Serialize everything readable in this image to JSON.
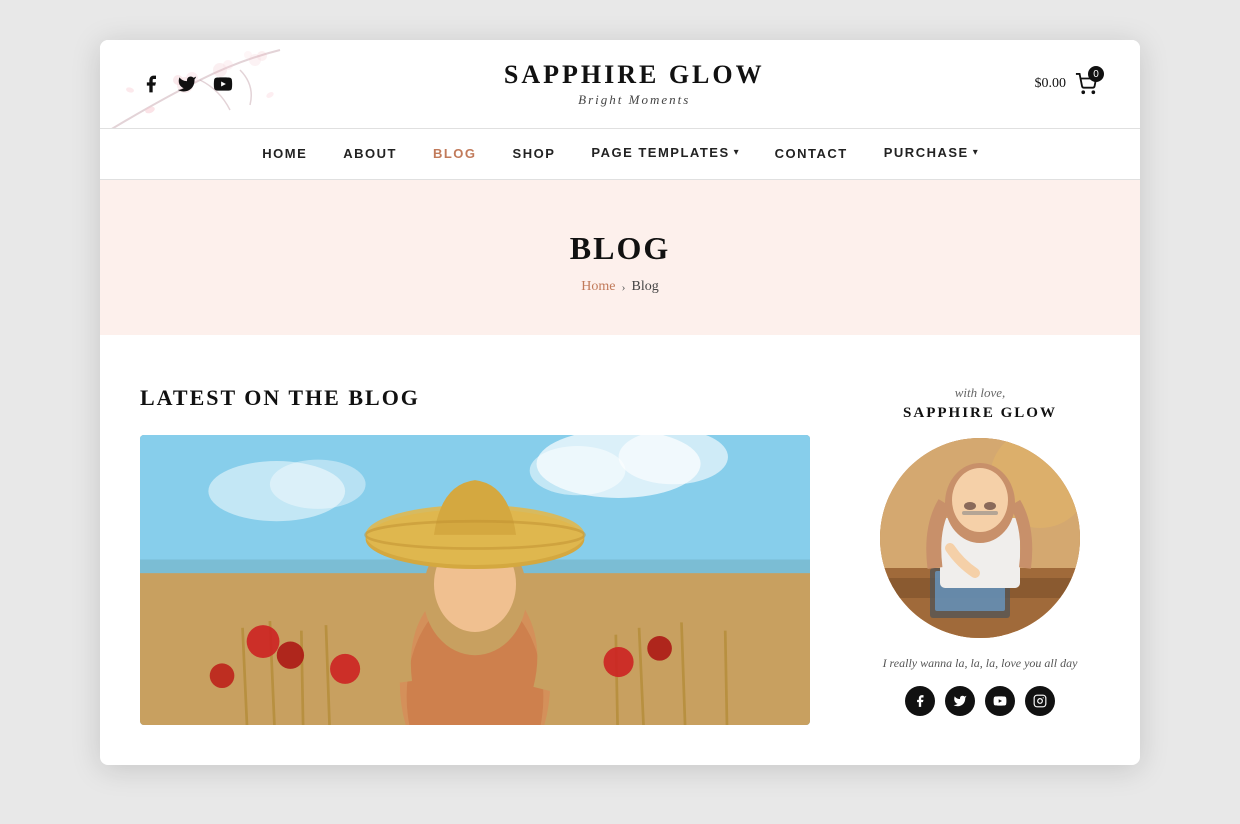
{
  "site": {
    "title": "SAPPHIRE GLOW",
    "tagline": "Bright Moments",
    "cart_price": "$0.00",
    "cart_count": "0"
  },
  "nav": {
    "items": [
      {
        "label": "HOME",
        "active": false
      },
      {
        "label": "ABOUT",
        "active": false
      },
      {
        "label": "BLOG",
        "active": true
      },
      {
        "label": "SHOP",
        "active": false
      },
      {
        "label": "PAGE TEMPLATES",
        "active": false,
        "has_arrow": true
      },
      {
        "label": "CONTACT",
        "active": false
      },
      {
        "label": "PURCHASE",
        "active": false,
        "has_arrow": true
      }
    ]
  },
  "hero": {
    "title": "BLOG",
    "breadcrumb_home": "Home",
    "breadcrumb_separator": "›",
    "breadcrumb_current": "Blog"
  },
  "main": {
    "section_title": "LATEST ON THE BLOG"
  },
  "sidebar": {
    "with_love_label": "with love,",
    "brand_name": "SAPPHIRE GLOW",
    "quote": "I really wanna la, la, la, love you all day"
  },
  "social": {
    "facebook_label": "facebook-icon",
    "twitter_label": "twitter-icon",
    "youtube_label": "youtube-icon"
  }
}
